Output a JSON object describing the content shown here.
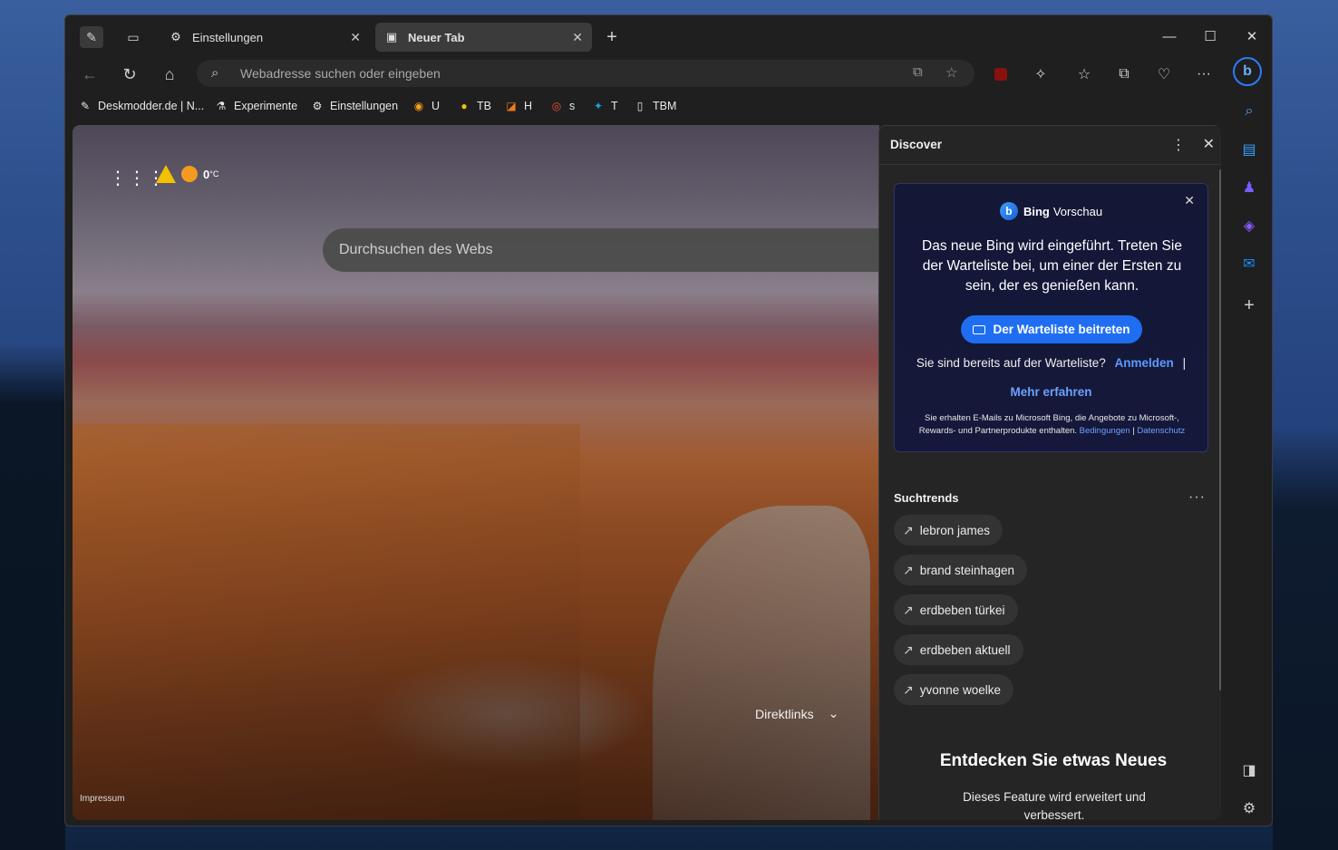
{
  "window": {
    "tabs": [
      {
        "label": "Einstellungen",
        "icon": "gear-icon"
      },
      {
        "label": "Neuer Tab",
        "icon": "newtab-icon",
        "active": true
      }
    ]
  },
  "address_bar": {
    "placeholder": "Webadresse suchen oder eingeben"
  },
  "bookmarks": [
    {
      "label": "Deskmodder.de | N...",
      "icon": "pen-icon"
    },
    {
      "label": "Experimente",
      "icon": "flask-icon"
    },
    {
      "label": "Einstellungen",
      "icon": "gear-icon"
    },
    {
      "label": "U",
      "icon": "ubuntu-icon"
    },
    {
      "label": "TB",
      "icon": "tb-icon"
    },
    {
      "label": "H",
      "icon": "h-icon"
    },
    {
      "label": "s",
      "icon": "s-icon"
    },
    {
      "label": "T",
      "icon": "twitter-icon"
    },
    {
      "label": "TBM",
      "icon": "page-icon"
    }
  ],
  "ntp": {
    "temperature": "0",
    "temperature_unit": "°C",
    "search_placeholder": "Durchsuchen des Webs",
    "quicklinks_label": "Direktlinks",
    "footer_link": "Impressum"
  },
  "discover": {
    "title": "Discover",
    "bing_card": {
      "brand_bold": "Bing",
      "brand_rest": "Vorschau",
      "message": "Das neue Bing wird eingeführt. Treten Sie der Warteliste bei, um einer der Ersten zu sein, der es genießen kann.",
      "join_button": "Der Warteliste beitreten",
      "already_text": "Sie sind bereits auf der Warteliste?",
      "signin_link": "Anmelden",
      "separator": "|",
      "learn_more": "Mehr erfahren",
      "fine_print": "Sie erhalten E-Mails zu Microsoft Bing, die Angebote zu Microsoft-, Rewards- und Partnerprodukte enthalten.",
      "terms_link": "Bedingungen",
      "privacy_link": "Datenschutz"
    },
    "trends_title": "Suchtrends",
    "trends": [
      "lebron james",
      "brand steinhagen",
      "erdbeben türkei",
      "erdbeben aktuell",
      "yvonne woelke"
    ],
    "new_title": "Entdecken Sie etwas Neues",
    "new_text": "Dieses Feature wird erweitert und verbessert."
  }
}
